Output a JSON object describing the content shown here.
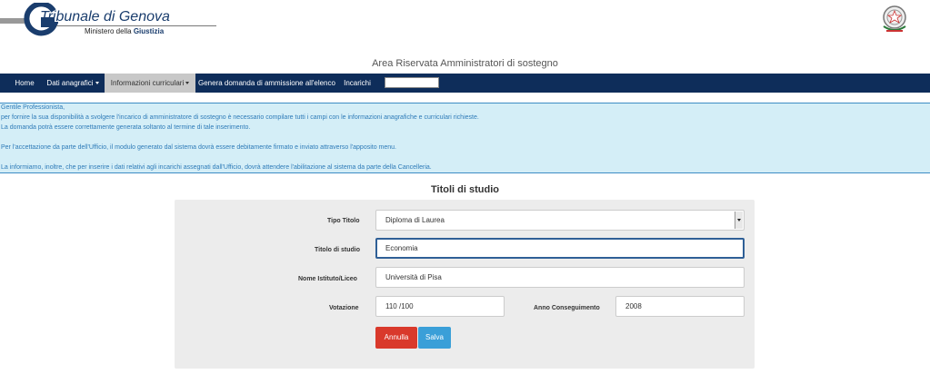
{
  "header": {
    "logo_title": "Tribunale di Genova",
    "logo_sub_prefix": "Ministero della",
    "logo_sub_bold": "Giustizia",
    "area_title": "Area Riservata Amministratori di sostegno"
  },
  "nav": {
    "items": [
      {
        "label": "Home"
      },
      {
        "label": "Dati anagrafici"
      },
      {
        "label": "Informazioni curriculari"
      },
      {
        "label": "Genera domanda di ammissione all'elenco"
      },
      {
        "label": "Incarichi"
      }
    ]
  },
  "notice": {
    "lines": [
      "Gentile Professionista,",
      "per fornire la sua disponibilità a svolgere l'incarico di amministratore di sostegno è necessario compilare tutti i campi con le informazioni anagrafiche e curriculari richieste.",
      "La domanda potrà essere correttamente generata soltanto al termine di tale inserimento.",
      "Per l'accettazione da parte dell'Ufficio, il modulo generato dal sistema dovrà essere debitamente firmato e inviato attraverso l'apposito menu.",
      "La informiamo, inoltre, che per inserire i dati relativi agli incarichi assegnati dall'Ufficio, dovrà attendere l'abilitazione al sistema da parte della Cancelleria."
    ]
  },
  "form": {
    "title": "Titoli di studio",
    "tipo_titolo_label": "Tipo Titolo",
    "tipo_titolo_value": "Diploma di Laurea",
    "titolo_label": "Titolo di studio",
    "titolo_value": "Economia",
    "istituto_label": "Nome Istituto/Liceo",
    "istituto_value": "Università di Pisa",
    "votazione_label": "Votazione",
    "votazione_value": "110 /100",
    "anno_label": "Anno Conseguimento",
    "anno_value": "2008",
    "annulla_label": "Annulla",
    "salva_label": "Salva"
  },
  "colors": {
    "navbar": "#0e2d5a",
    "notice_bg": "#d4eef7",
    "notice_text": "#2e7bb8",
    "annulla": "#d9392b",
    "salva": "#3a9fd8"
  }
}
